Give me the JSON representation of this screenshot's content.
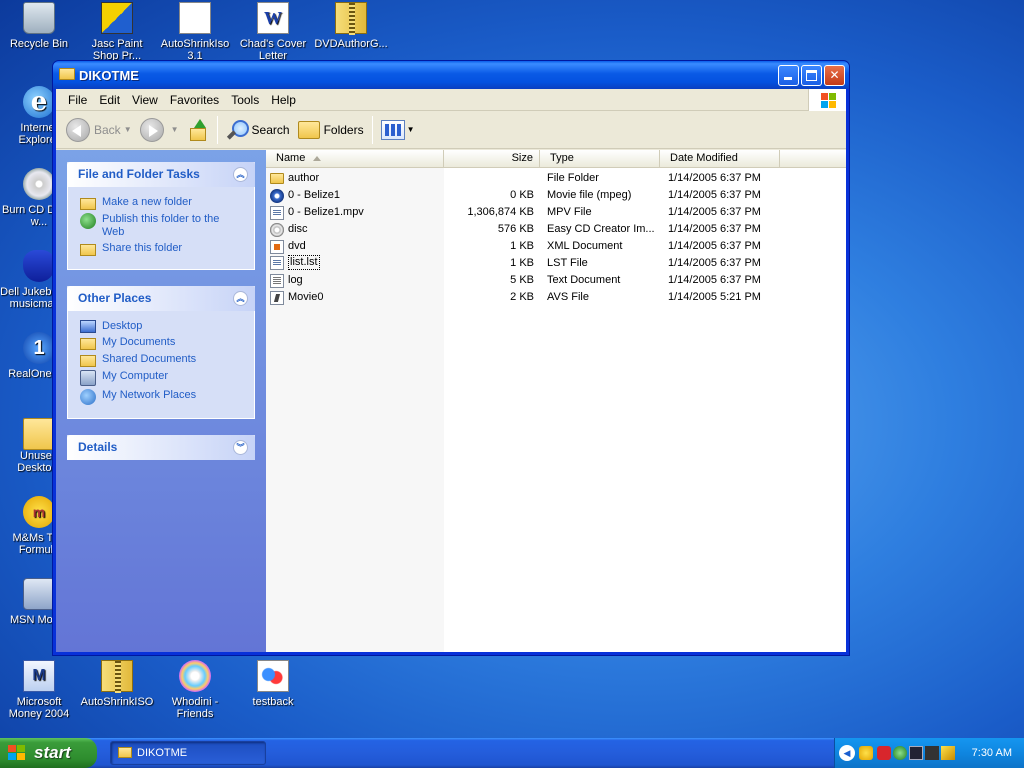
{
  "desktop": {
    "icons": [
      {
        "label": "Recycle Bin",
        "icon": "recycle-bin-icon"
      },
      {
        "label": "Jasc Paint Shop Pr...",
        "icon": "paint-shop-icon"
      },
      {
        "label": "AutoShrinkIso 3.1",
        "icon": "shortcut-icon"
      },
      {
        "label": "Chad's Cover Letter",
        "icon": "word-document-icon"
      },
      {
        "label": "DVDAuthorG...",
        "icon": "zip-archive-icon"
      },
      {
        "label": "Internet Explorer",
        "icon": "internet-explorer-icon"
      },
      {
        "label": "Burn CD DVDs w...",
        "icon": "cd-burn-icon"
      },
      {
        "label": "Dell Jukebox by musicmatch",
        "icon": "jukebox-icon"
      },
      {
        "label": "RealOne P...",
        "icon": "realone-icon"
      },
      {
        "label": "Unused Deskto...",
        "icon": "folder-icon"
      },
      {
        "label": "M&Ms The Formula",
        "icon": "mms-icon"
      },
      {
        "label": "MSN Mon...",
        "icon": "msn-icon"
      },
      {
        "label": "Microsoft Money 2004",
        "icon": "money-icon"
      },
      {
        "label": "AutoShrinkISO",
        "icon": "zip-archive-icon"
      },
      {
        "label": "Whodini - Friends",
        "icon": "media-file-icon"
      },
      {
        "label": "testback",
        "icon": "image-file-icon"
      }
    ]
  },
  "window": {
    "title": "DIKOTME",
    "menu": [
      "File",
      "Edit",
      "View",
      "Favorites",
      "Tools",
      "Help"
    ],
    "toolbar": {
      "back": "Back",
      "search": "Search",
      "folders": "Folders"
    },
    "left_pane": {
      "file_tasks": {
        "title": "File and Folder Tasks",
        "items": [
          {
            "label": "Make a new folder",
            "icon": "new-folder-icon"
          },
          {
            "label": "Publish this folder to the Web",
            "icon": "publish-web-icon"
          },
          {
            "label": "Share this folder",
            "icon": "share-folder-icon"
          }
        ]
      },
      "other_places": {
        "title": "Other Places",
        "items": [
          {
            "label": "Desktop",
            "icon": "desktop-icon"
          },
          {
            "label": "My Documents",
            "icon": "my-documents-icon"
          },
          {
            "label": "Shared Documents",
            "icon": "shared-documents-icon"
          },
          {
            "label": "My Computer",
            "icon": "my-computer-icon"
          },
          {
            "label": "My Network Places",
            "icon": "network-places-icon"
          }
        ]
      },
      "details": {
        "title": "Details"
      }
    },
    "columns": {
      "name": "Name",
      "size": "Size",
      "type": "Type",
      "date": "Date Modified"
    },
    "files": [
      {
        "name": "author",
        "size": "",
        "type": "File Folder",
        "date": "1/14/2005 6:37 PM",
        "icon": "folder"
      },
      {
        "name": "0 - Belize1",
        "size": "0 KB",
        "type": "Movie file (mpeg)",
        "date": "1/14/2005 6:37 PM",
        "icon": "media"
      },
      {
        "name": "0 - Belize1.mpv",
        "size": "1,306,874 KB",
        "type": "MPV File",
        "date": "1/14/2005 6:37 PM",
        "icon": "file"
      },
      {
        "name": "disc",
        "size": "576 KB",
        "type": "Easy CD Creator Im...",
        "date": "1/14/2005 6:37 PM",
        "icon": "disc"
      },
      {
        "name": "dvd",
        "size": "1 KB",
        "type": "XML Document",
        "date": "1/14/2005 6:37 PM",
        "icon": "xml"
      },
      {
        "name": "list.lst",
        "size": "1 KB",
        "type": "LST File",
        "date": "1/14/2005 6:37 PM",
        "icon": "file"
      },
      {
        "name": "log",
        "size": "5 KB",
        "type": "Text Document",
        "date": "1/14/2005 6:37 PM",
        "icon": "text"
      },
      {
        "name": "Movie0",
        "size": "2 KB",
        "type": "AVS File",
        "date": "1/14/2005 5:21 PM",
        "icon": "avs"
      }
    ]
  },
  "taskbar": {
    "start": "start",
    "task": "DIKOTME",
    "clock": "7:30 AM"
  }
}
